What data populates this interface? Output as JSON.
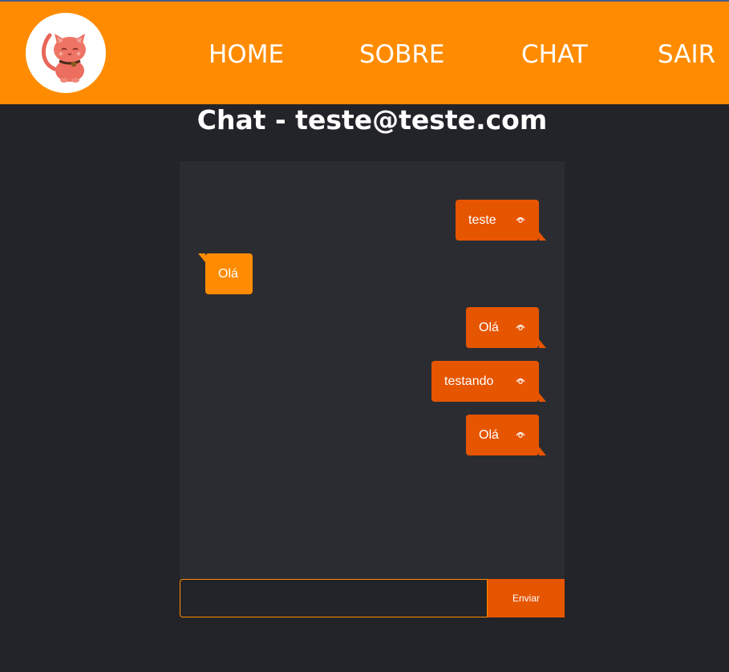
{
  "nav": {
    "logo_icon": "cat-mascot-icon",
    "links": [
      "HOME",
      "SOBRE",
      "CHAT",
      "SAIR"
    ]
  },
  "page": {
    "title": "Chat - teste@teste.com"
  },
  "chat": {
    "messages": [
      {
        "text": "teste",
        "direction": "sent",
        "seen_icon": "eye-icon"
      },
      {
        "text": "Olá",
        "direction": "received"
      },
      {
        "text": "Olá",
        "direction": "sent",
        "seen_icon": "eye-icon"
      },
      {
        "text": "testando",
        "direction": "sent",
        "seen_icon": "eye-icon"
      },
      {
        "text": "Olá",
        "direction": "sent",
        "seen_icon": "eye-icon"
      }
    ]
  },
  "composer": {
    "input_value": "",
    "input_placeholder": "",
    "send_label": "Enviar"
  },
  "colors": {
    "navbar": "#ff8c00",
    "background": "#232429",
    "panel": "#2b2c31",
    "sent_bubble": "#e65500",
    "received_bubble": "#ff8c00"
  }
}
